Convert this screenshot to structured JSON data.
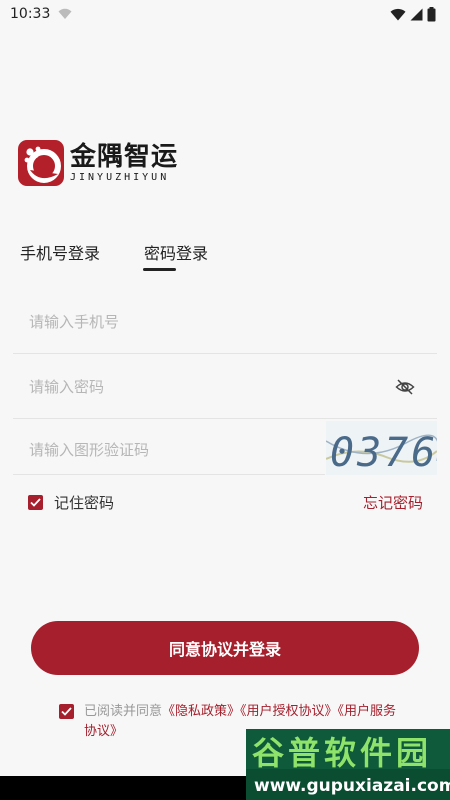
{
  "status_bar": {
    "time": "10:33"
  },
  "logo": {
    "name_cn": "金隅智运",
    "name_en": "JINYUZHIYUN"
  },
  "tabs": [
    {
      "label": "手机号登录",
      "active": false
    },
    {
      "label": "密码登录",
      "active": true
    }
  ],
  "form": {
    "phone_placeholder": "请输入手机号",
    "password_placeholder": "请输入密码",
    "captcha_placeholder": "请输入图形验证码",
    "captcha_code": "0376",
    "remember_label": "记住密码",
    "remember_checked": true,
    "forgot_label": "忘记密码"
  },
  "login_button": "同意协议并登录",
  "agreement": {
    "checked": true,
    "prefix": "已阅读并同意",
    "privacy": "《隐私政策》",
    "license": "《用户授权协议》",
    "service": "《用户服务协议》"
  },
  "watermark": {
    "cn": "谷普软件园",
    "url": "www.gupuxiazai.com"
  },
  "colors": {
    "accent": "#a51f2c",
    "background": "#f7f7f7"
  },
  "icons": [
    "wifi-icon",
    "signal-icon",
    "battery-icon",
    "eye-off-icon",
    "checkbox-checked-icon"
  ]
}
